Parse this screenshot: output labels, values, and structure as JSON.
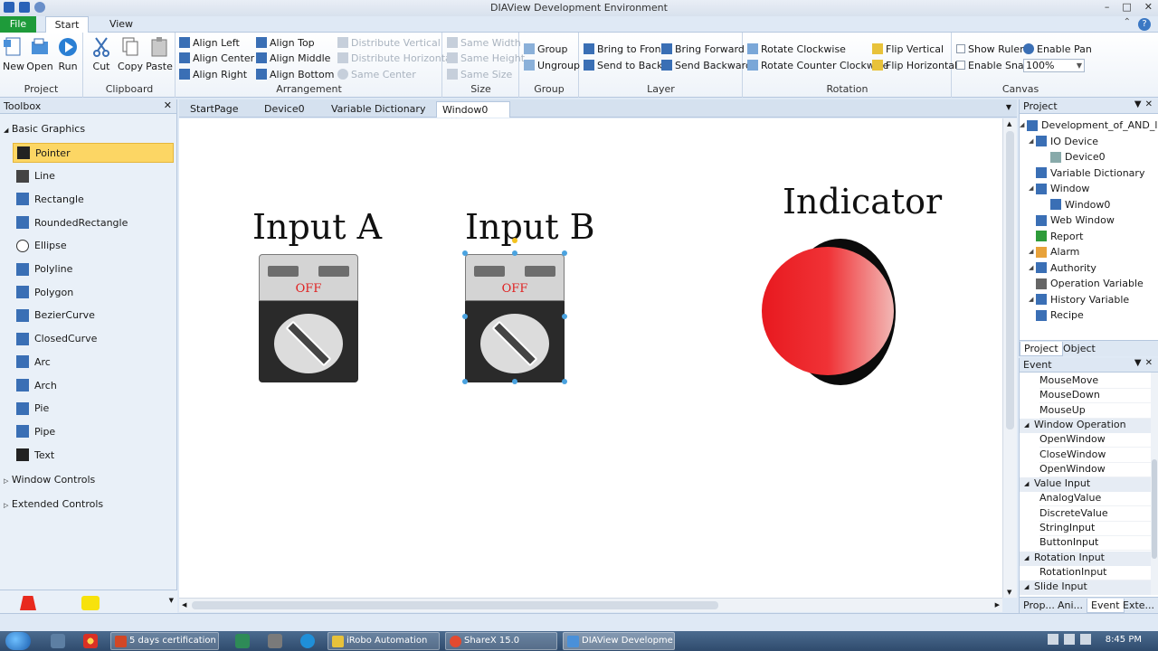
{
  "window": {
    "title": "DIAView Development Environment"
  },
  "ribbon": {
    "tabs": [
      "File",
      "Start",
      "View"
    ],
    "project": {
      "label": "Project",
      "new": "New",
      "open": "Open",
      "run": "Run"
    },
    "clipboard": {
      "label": "Clipboard",
      "cut": "Cut",
      "copy": "Copy",
      "paste": "Paste"
    },
    "arrangement": {
      "label": "Arrangement",
      "align_left": "Align Left",
      "align_center": "Align Center",
      "align_right": "Align Right",
      "align_top": "Align Top",
      "align_middle": "Align Middle",
      "align_bottom": "Align Bottom",
      "distribute_vertical": "Distribute Vertical",
      "distribute_horizontal": "Distribute Horizontal",
      "same_center": "Same Center"
    },
    "size": {
      "label": "Size",
      "same_width": "Same Width",
      "same_height": "Same Height",
      "same_size": "Same Size"
    },
    "group": {
      "label": "Group",
      "group": "Group",
      "ungroup": "Ungroup"
    },
    "layer": {
      "label": "Layer",
      "bring_to_front": "Bring to Front",
      "send_to_back": "Send to Back",
      "bring_forward": "Bring Forward",
      "send_backward": "Send Backward"
    },
    "rotation": {
      "label": "Rotation",
      "rotate_cw": "Rotate Clockwise",
      "rotate_ccw": "Rotate Counter Clockwise",
      "flip_vertical": "Flip Vertical",
      "flip_horizontal": "Flip Horizontal"
    },
    "canvas": {
      "label": "Canvas",
      "show_ruler": "Show Ruler",
      "enable_snap": "Enable Snap",
      "enable_pan": "Enable Pan",
      "zoom": "100%"
    }
  },
  "toolbox": {
    "title": "Toolbox",
    "section_basic": "Basic Graphics",
    "items": [
      "Pointer",
      "Line",
      "Rectangle",
      "RoundedRectangle",
      "Ellipse",
      "Polyline",
      "Polygon",
      "BezierCurve",
      "ClosedCurve",
      "Arc",
      "Arch",
      "Pie",
      "Pipe",
      "Text"
    ],
    "section_window": "Window Controls",
    "section_extended": "Extended Controls"
  },
  "doc_tabs": [
    "StartPage",
    "Device0",
    "Variable Dictionary",
    "Window0"
  ],
  "canvas": {
    "label_a": "Input A",
    "label_b": "Input B",
    "label_indicator": "Indicator",
    "switch_state": "OFF"
  },
  "project_panel": {
    "title": "Project",
    "tree": [
      "Development_of_AND_l",
      "IO Device",
      "Device0",
      "Variable Dictionary",
      "Window",
      "Window0",
      "Web Window",
      "Report",
      "Alarm",
      "Authority",
      "Operation Variable",
      "History Variable",
      "Recipe"
    ],
    "tabs": [
      "Project",
      "Object"
    ]
  },
  "event_panel": {
    "title": "Event",
    "mouse_items": [
      "MouseMove",
      "MouseDown",
      "MouseUp"
    ],
    "section_window_op": "Window Operation",
    "window_op_items": [
      "OpenWindow",
      "CloseWindow",
      "OpenWindow"
    ],
    "section_value_input": "Value Input",
    "value_input_items": [
      "AnalogValue",
      "DiscreteValue",
      "StringInput",
      "ButtonInput"
    ],
    "section_rotation_input": "Rotation Input",
    "rotation_input_items": [
      "RotationInput"
    ],
    "section_slide_input": "Slide Input",
    "tabs": [
      "Prop...",
      "Ani...",
      "Event",
      "Exte..."
    ]
  },
  "taskbar": {
    "tasks": [
      "5 days certification c...",
      "iRobo Automation",
      "ShareX 15.0",
      "DIAView Developme..."
    ],
    "clock": "8:45 PM"
  },
  "colors": {
    "file_tab": "#1e9b3a",
    "selection": "#fcd664",
    "indicator_red": "#e8191f",
    "off_text": "#e02020"
  }
}
